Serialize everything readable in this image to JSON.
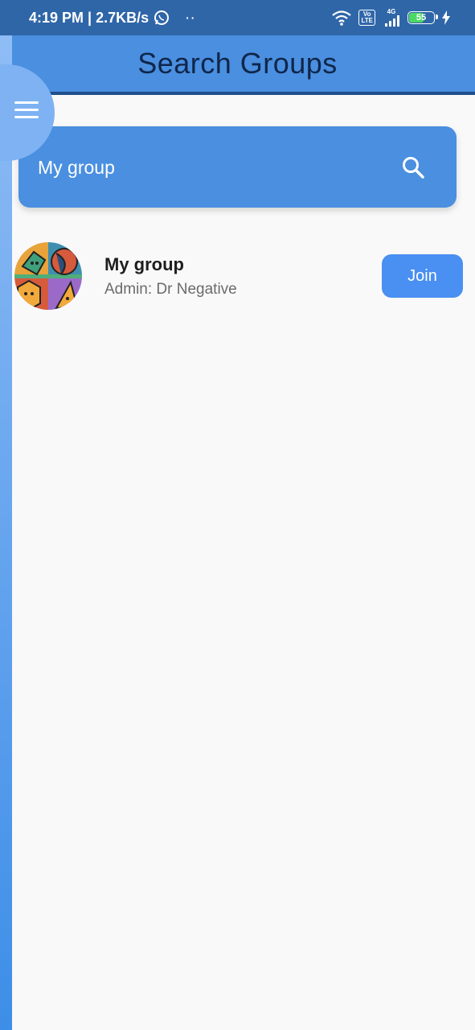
{
  "status_bar": {
    "time_speed": "4:19 PM | 2.7KB/s",
    "dots": "··",
    "network_label": "4G",
    "volte_label": "Vo\nLTE",
    "battery_level": "55"
  },
  "header": {
    "title": "Search Groups"
  },
  "search": {
    "value": "My group"
  },
  "results": [
    {
      "name": "My group",
      "admin": "Admin: Dr Negative",
      "action_label": "Join"
    }
  ],
  "colors": {
    "status_bar": "#2f66a8",
    "header": "#4a8fe0",
    "header_border": "#1f4f8c",
    "search_box": "#4a8fe0",
    "join_button": "#4a8ff2",
    "background": "#f9f9f9"
  },
  "icons": {
    "menu": "hamburger-menu-icon",
    "search": "search-icon",
    "whatsapp": "whatsapp-icon",
    "wifi": "wifi-icon",
    "signal": "signal-icon",
    "battery": "battery-icon",
    "charging": "charging-bolt-icon"
  }
}
